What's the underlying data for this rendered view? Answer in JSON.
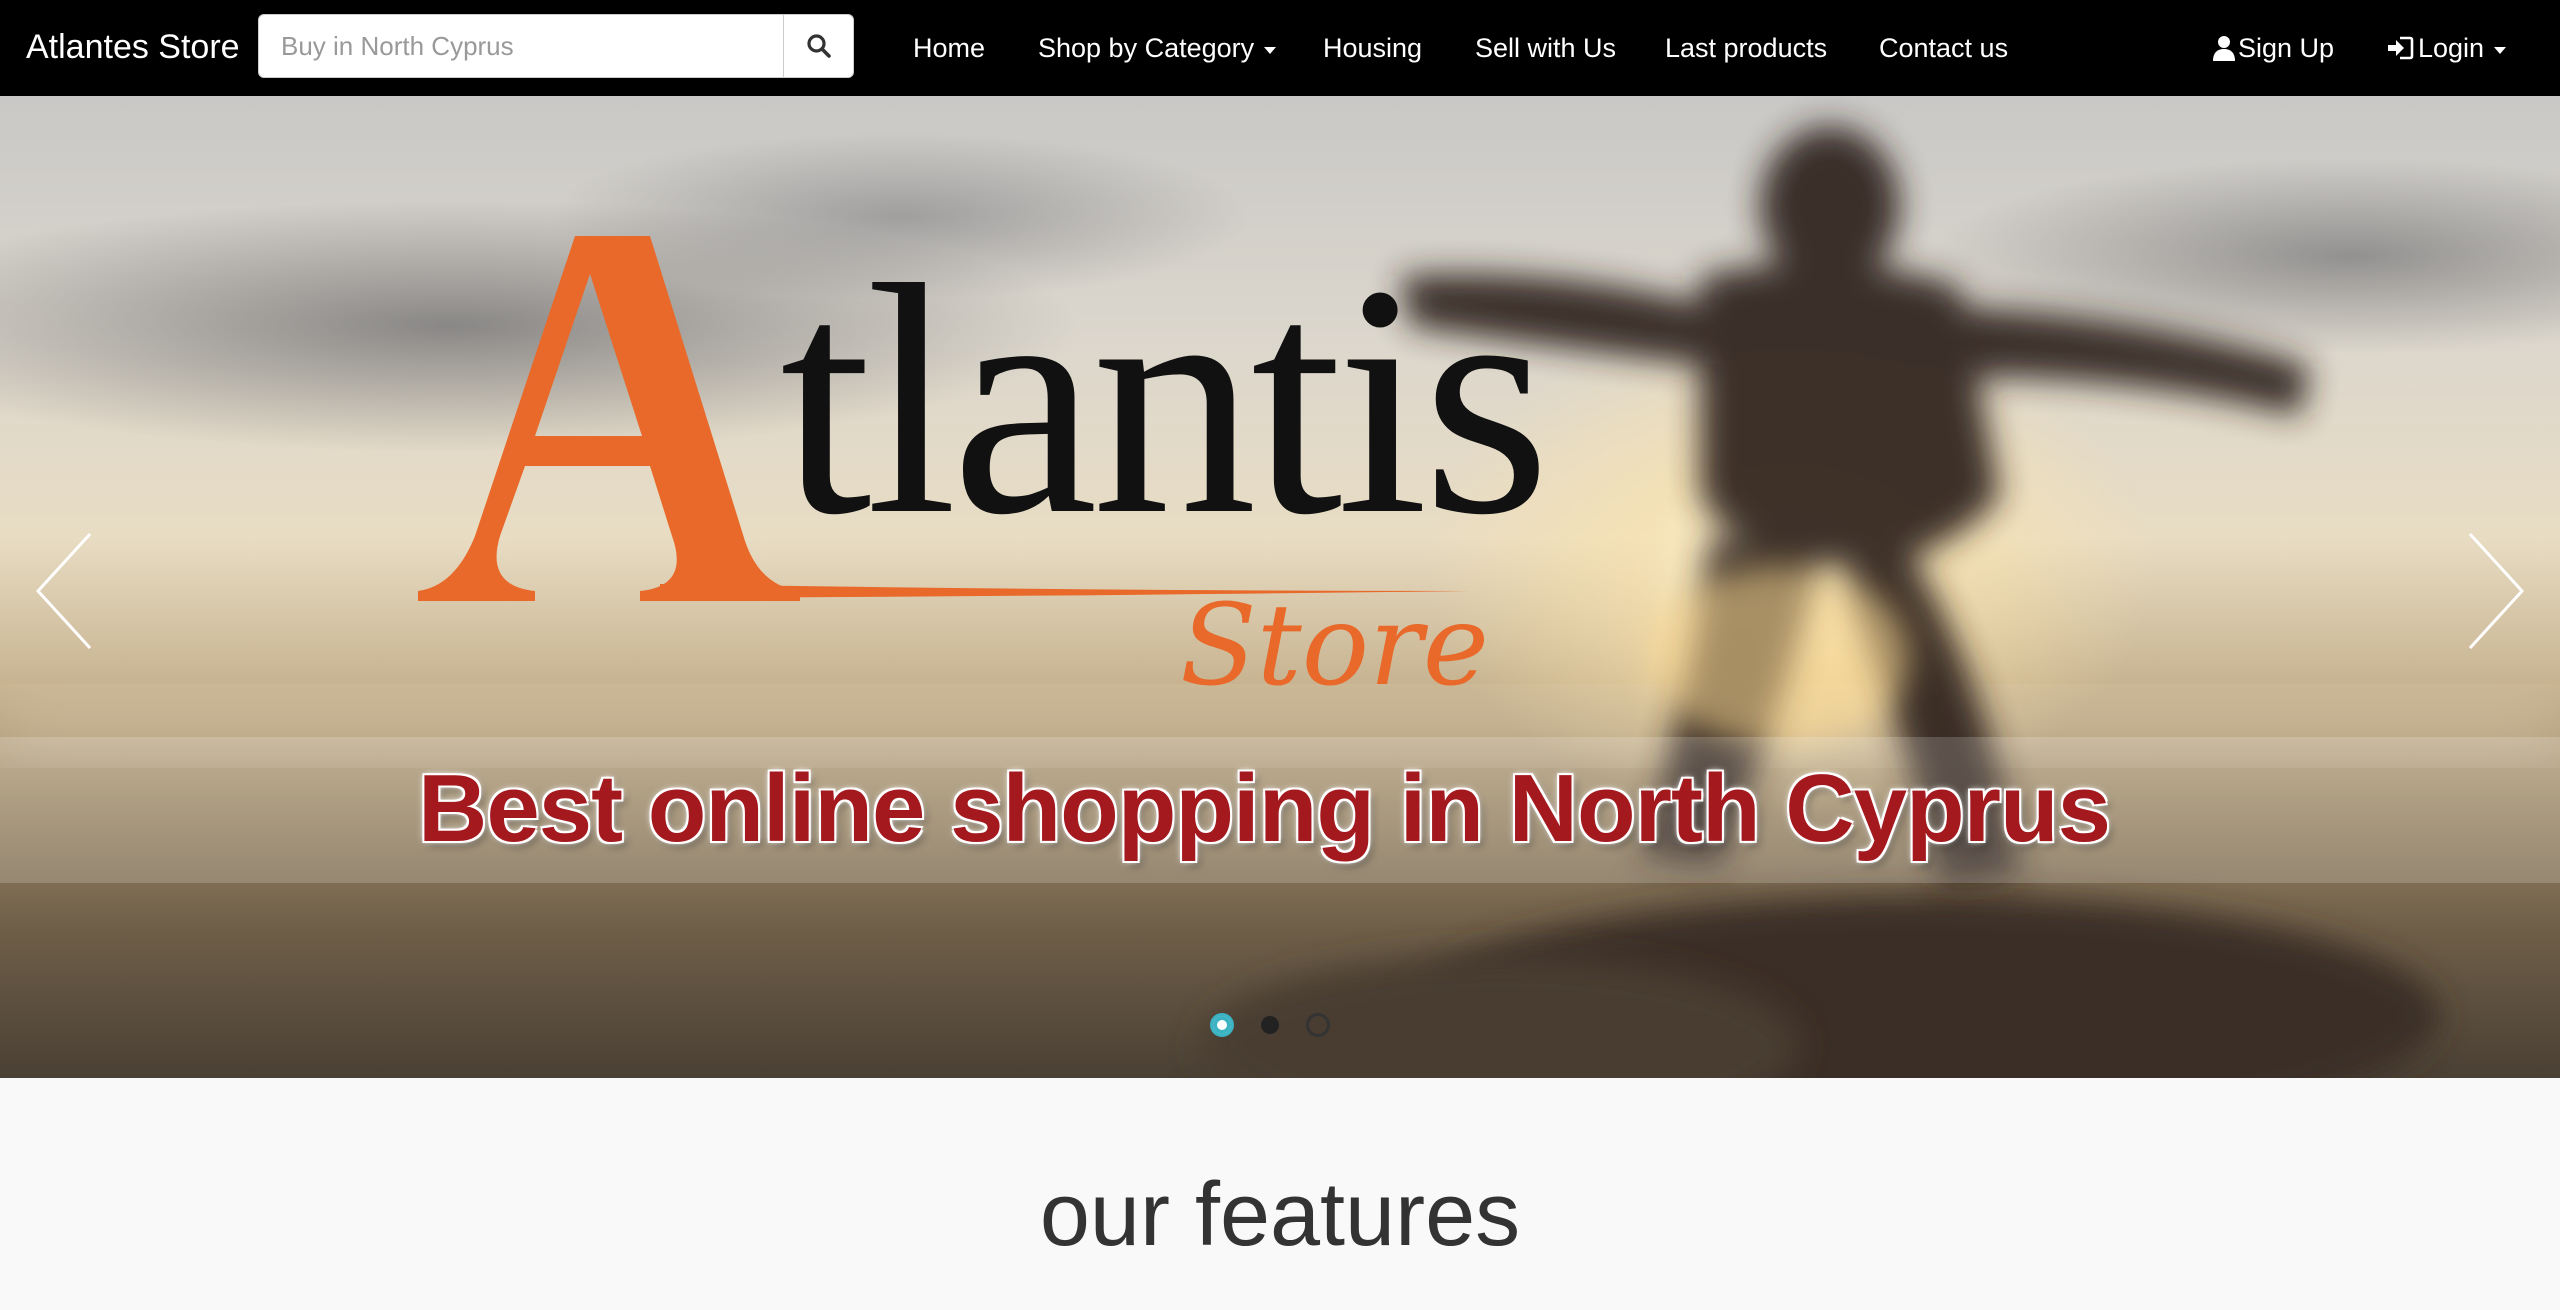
{
  "navbar": {
    "brand": "Atlantes Store",
    "search": {
      "placeholder": "Buy in North Cyprus",
      "value": "",
      "button_icon": "search-icon"
    },
    "items": [
      {
        "label": "Home"
      },
      {
        "label": "Shop by Category",
        "dropdown": true
      },
      {
        "label": "Housing"
      },
      {
        "label": "Sell with Us"
      },
      {
        "label": "Last products"
      },
      {
        "label": "Contact us"
      }
    ],
    "right": {
      "signup": {
        "label": "Sign Up",
        "icon": "user-icon"
      },
      "login": {
        "label": "Login",
        "icon": "login-icon",
        "dropdown": true
      }
    }
  },
  "carousel": {
    "logo": {
      "initial": "A",
      "rest": "tlantis",
      "sub": "Store"
    },
    "tagline": "Best online shopping in North Cyprus",
    "prev_icon": "chevron-left-icon",
    "next_icon": "chevron-right-icon",
    "slide_count": 3,
    "active_slide": 1
  },
  "features": {
    "heading": "our features"
  },
  "colors": {
    "navbar_bg": "#000000",
    "logo_orange": "#e8692a",
    "tagline_red": "#a3191e",
    "indicator_active": "#3bb3c3"
  }
}
